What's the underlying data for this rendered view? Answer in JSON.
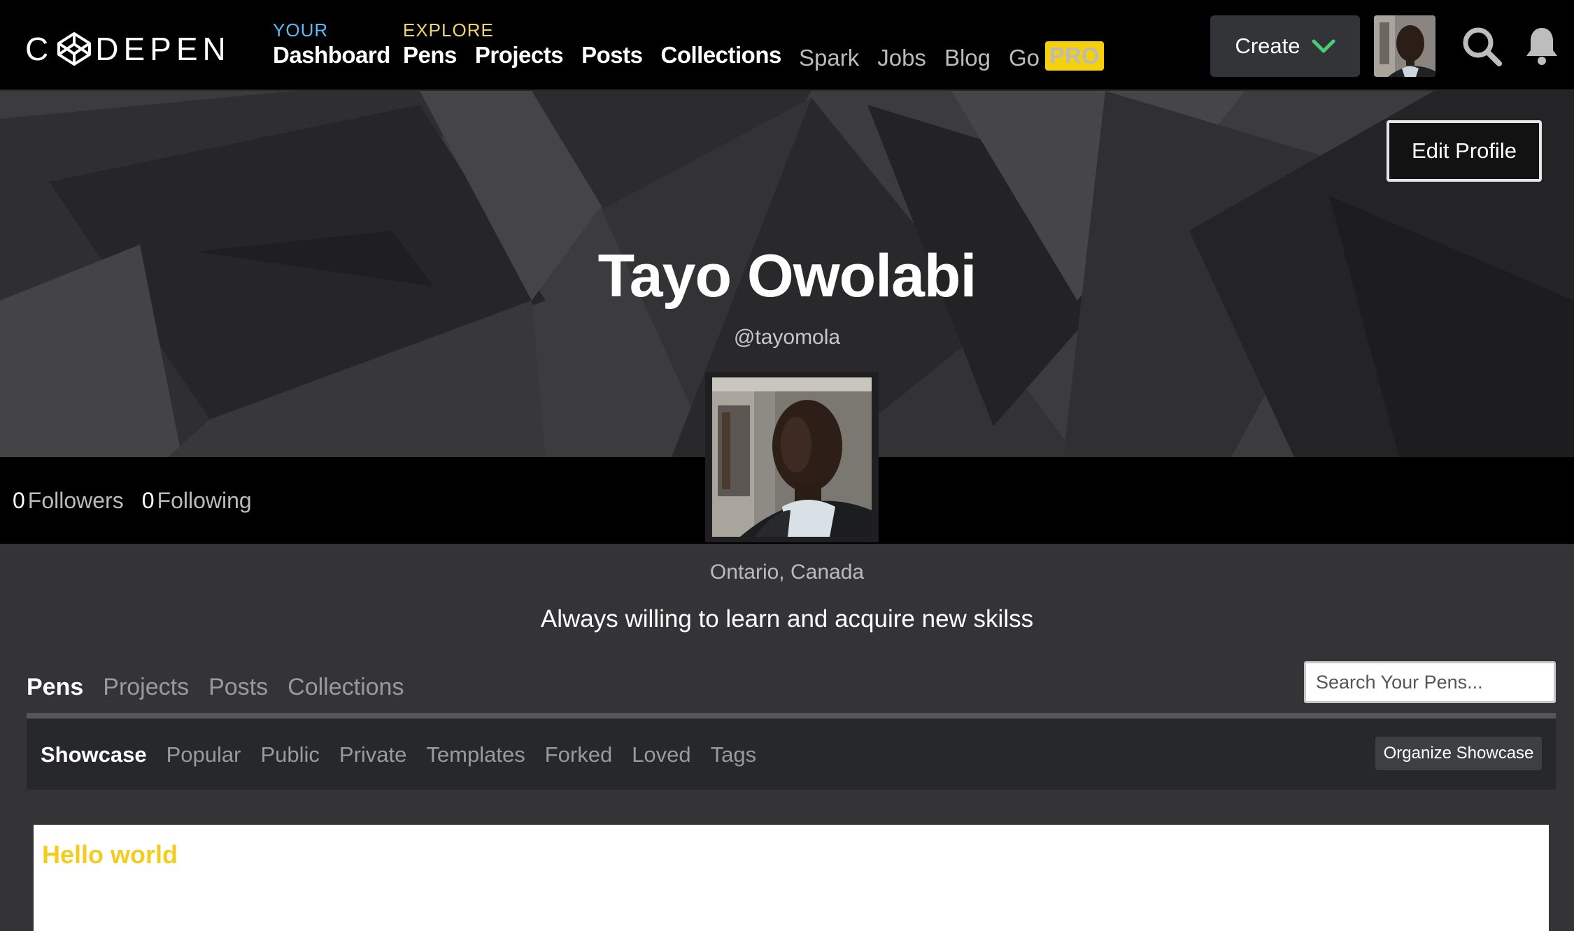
{
  "brand": {
    "name": "CDEPEN"
  },
  "nav": {
    "your": {
      "eyebrow": "YOUR",
      "eyebrow_color": "#5eb8f7",
      "links": [
        "Dashboard"
      ]
    },
    "explore": {
      "eyebrow": "EXPLORE",
      "eyebrow_color": "#f0d36c",
      "links": [
        "Pens",
        "Projects",
        "Posts",
        "Collections"
      ]
    },
    "secondary": [
      "Spark",
      "Jobs",
      "Blog"
    ],
    "go": {
      "label": "Go",
      "badge": "PRO"
    },
    "create_label": "Create",
    "icons": [
      "search-icon",
      "bell-icon",
      "chevron-down-icon"
    ]
  },
  "profile": {
    "edit_label": "Edit Profile",
    "name": "Tayo Owolabi",
    "handle": "@tayomola",
    "followers_count": "0",
    "followers_label": "Followers",
    "following_count": "0",
    "following_label": "Following",
    "location": "Ontario, Canada",
    "bio": "Always willing to learn and acquire new skilss"
  },
  "tabs": {
    "main": [
      "Pens",
      "Projects",
      "Posts",
      "Collections"
    ],
    "active_main": "Pens",
    "search_placeholder": "Search Your Pens...",
    "sub": [
      "Showcase",
      "Popular",
      "Public",
      "Private",
      "Templates",
      "Forked",
      "Loved",
      "Tags"
    ],
    "active_sub": "Showcase",
    "organize_label": "Organize Showcase"
  },
  "showcase": {
    "preview_text": "Hello world",
    "preview_text_color": "#f2cd1f"
  },
  "colors": {
    "accent_green": "#47cf73",
    "pro_yellow": "#f6d10a"
  }
}
